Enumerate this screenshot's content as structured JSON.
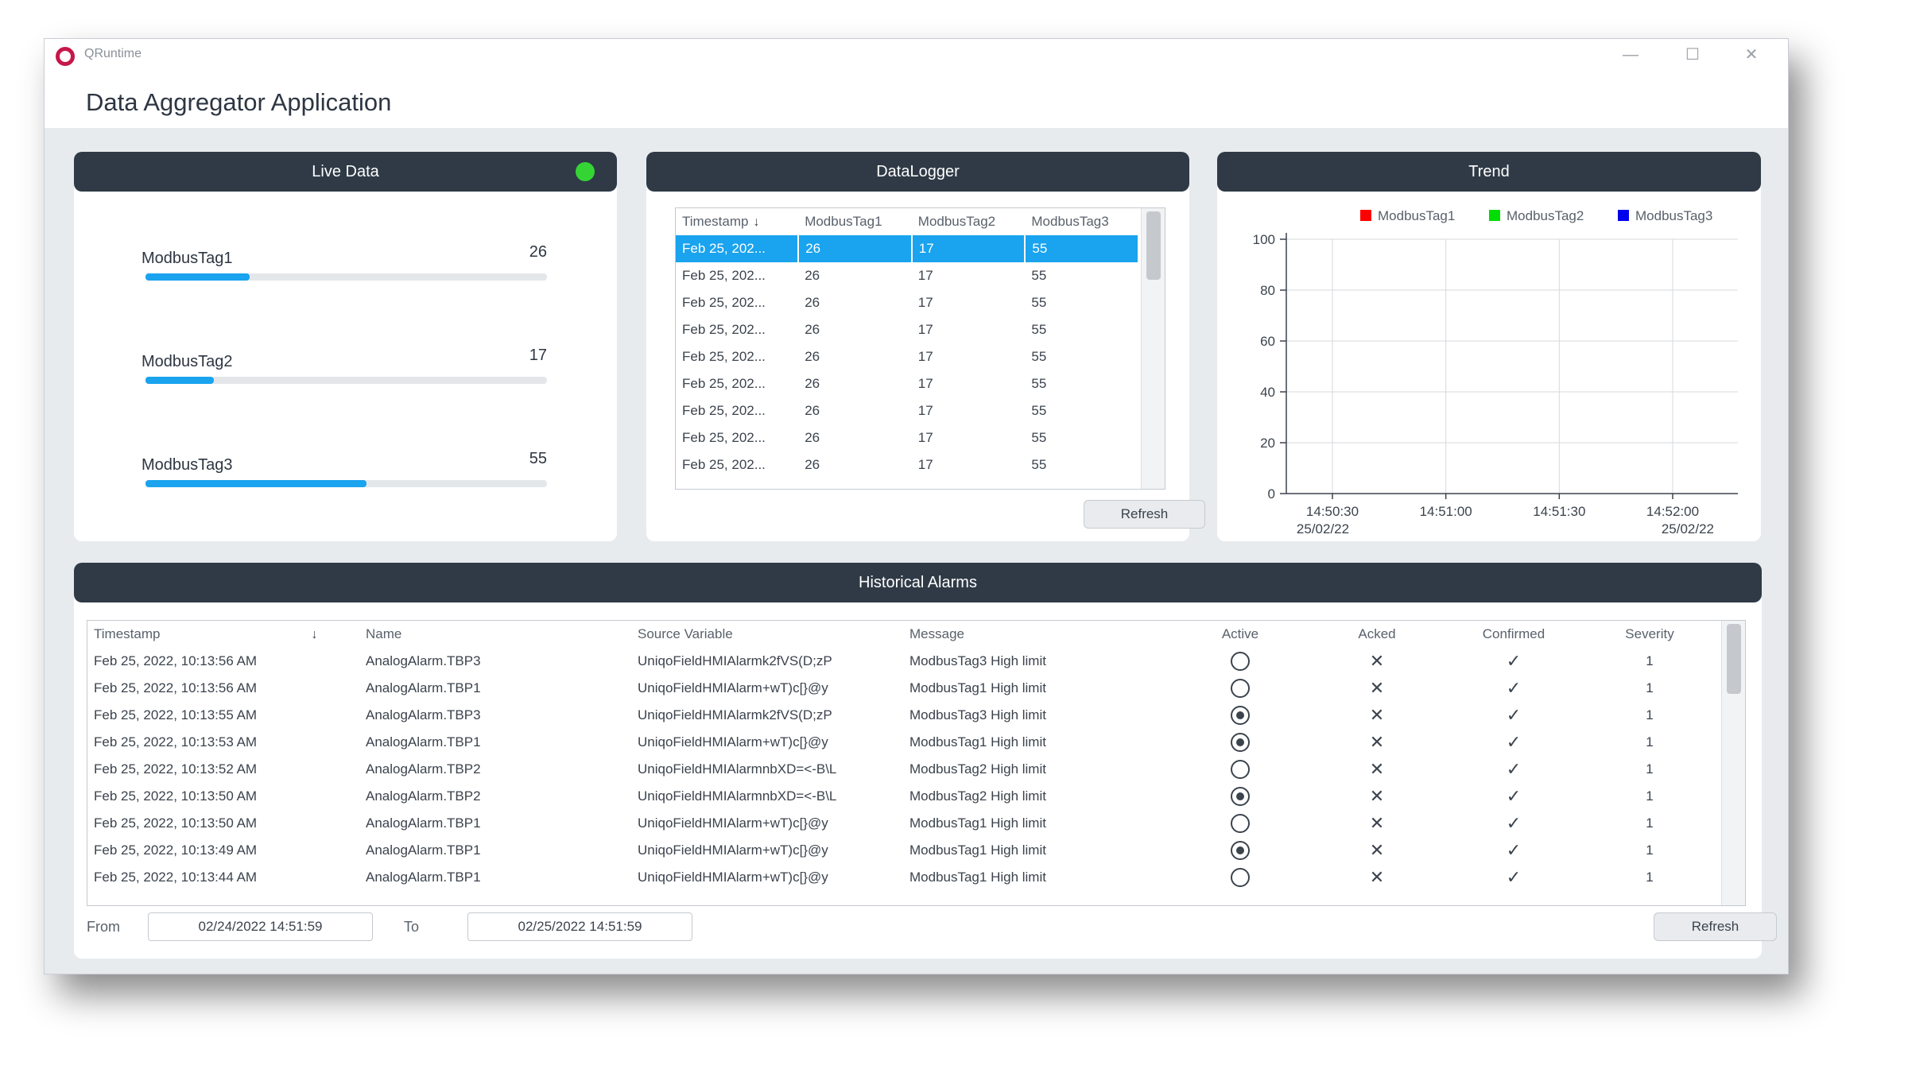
{
  "window": {
    "app_name": "QRuntime",
    "title": "Data Aggregator Application",
    "controls": {
      "minimize": "—",
      "maximize": "☐",
      "close": "✕"
    }
  },
  "colors": {
    "header": "#2f3a46",
    "accent": "#1aa3ee",
    "status_ok": "#35d435"
  },
  "live_data": {
    "title": "Live Data",
    "tags": [
      {
        "label": "ModbusTag1",
        "value": "26",
        "fill": 0.26
      },
      {
        "label": "ModbusTag2",
        "value": "17",
        "fill": 0.17
      },
      {
        "label": "ModbusTag3",
        "value": "55",
        "fill": 0.55
      }
    ]
  },
  "datalogger": {
    "title": "DataLogger",
    "columns": [
      "Timestamp",
      "ModbusTag1",
      "ModbusTag2",
      "ModbusTag3"
    ],
    "rows": [
      [
        "Feb 25, 202...",
        "26",
        "17",
        "55"
      ],
      [
        "Feb 25, 202...",
        "26",
        "17",
        "55"
      ],
      [
        "Feb 25, 202...",
        "26",
        "17",
        "55"
      ],
      [
        "Feb 25, 202...",
        "26",
        "17",
        "55"
      ],
      [
        "Feb 25, 202...",
        "26",
        "17",
        "55"
      ],
      [
        "Feb 25, 202...",
        "26",
        "17",
        "55"
      ],
      [
        "Feb 25, 202...",
        "26",
        "17",
        "55"
      ],
      [
        "Feb 25, 202...",
        "26",
        "17",
        "55"
      ],
      [
        "Feb 25, 202...",
        "26",
        "17",
        "55"
      ]
    ],
    "refresh_label": "Refresh"
  },
  "trend": {
    "title": "Trend",
    "chart_data": {
      "type": "line",
      "title": "",
      "ylim": [
        0,
        100
      ],
      "yticks": [
        "0",
        "20",
        "40",
        "60",
        "80",
        "100"
      ],
      "xticks": [
        {
          "time": "14:50:30",
          "date": "25/02/22"
        },
        {
          "time": "14:51:00",
          "date": ""
        },
        {
          "time": "14:51:30",
          "date": ""
        },
        {
          "time": "14:52:00",
          "date": "25/02/22"
        }
      ],
      "series": [
        {
          "name": "ModbusTag1",
          "color": "#ff0000",
          "values": []
        },
        {
          "name": "ModbusTag2",
          "color": "#00dd00",
          "values": []
        },
        {
          "name": "ModbusTag3",
          "color": "#0000ee",
          "values": []
        }
      ],
      "grid": true,
      "legend": "top"
    }
  },
  "alarms": {
    "title": "Historical Alarms",
    "columns": [
      "Timestamp",
      "Name",
      "Source Variable",
      "Message",
      "Active",
      "Acked",
      "Confirmed",
      "Severity"
    ],
    "rows": [
      {
        "timestamp": "Feb 25, 2022, 10:13:56 AM",
        "name": "AnalogAlarm.TBP3",
        "source": "UniqoFieldHMIAlarmk2fVS(D;zP",
        "message": "ModbusTag3 High limit",
        "active": false,
        "acked": "✕",
        "confirmed": "✓",
        "severity": "1"
      },
      {
        "timestamp": "Feb 25, 2022, 10:13:56 AM",
        "name": "AnalogAlarm.TBP1",
        "source": "UniqoFieldHMIAlarm+wT)c[}@y",
        "message": "ModbusTag1 High limit",
        "active": false,
        "acked": "✕",
        "confirmed": "✓",
        "severity": "1"
      },
      {
        "timestamp": "Feb 25, 2022, 10:13:55 AM",
        "name": "AnalogAlarm.TBP3",
        "source": "UniqoFieldHMIAlarmk2fVS(D;zP",
        "message": "ModbusTag3 High limit",
        "active": true,
        "acked": "✕",
        "confirmed": "✓",
        "severity": "1"
      },
      {
        "timestamp": "Feb 25, 2022, 10:13:53 AM",
        "name": "AnalogAlarm.TBP1",
        "source": "UniqoFieldHMIAlarm+wT)c[}@y",
        "message": "ModbusTag1 High limit",
        "active": true,
        "acked": "✕",
        "confirmed": "✓",
        "severity": "1"
      },
      {
        "timestamp": "Feb 25, 2022, 10:13:52 AM",
        "name": "AnalogAlarm.TBP2",
        "source": "UniqoFieldHMIAlarmnbXD=<-B\\L",
        "message": "ModbusTag2 High limit",
        "active": false,
        "acked": "✕",
        "confirmed": "✓",
        "severity": "1"
      },
      {
        "timestamp": "Feb 25, 2022, 10:13:50 AM",
        "name": "AnalogAlarm.TBP2",
        "source": "UniqoFieldHMIAlarmnbXD=<-B\\L",
        "message": "ModbusTag2 High limit",
        "active": true,
        "acked": "✕",
        "confirmed": "✓",
        "severity": "1"
      },
      {
        "timestamp": "Feb 25, 2022, 10:13:50 AM",
        "name": "AnalogAlarm.TBP1",
        "source": "UniqoFieldHMIAlarm+wT)c[}@y",
        "message": "ModbusTag1 High limit",
        "active": false,
        "acked": "✕",
        "confirmed": "✓",
        "severity": "1"
      },
      {
        "timestamp": "Feb 25, 2022, 10:13:49 AM",
        "name": "AnalogAlarm.TBP1",
        "source": "UniqoFieldHMIAlarm+wT)c[}@y",
        "message": "ModbusTag1 High limit",
        "active": true,
        "acked": "✕",
        "confirmed": "✓",
        "severity": "1"
      },
      {
        "timestamp": "Feb 25, 2022, 10:13:44 AM",
        "name": "AnalogAlarm.TBP1",
        "source": "UniqoFieldHMIAlarm+wT)c[}@y",
        "message": "ModbusTag1 High limit",
        "active": false,
        "acked": "✕",
        "confirmed": "✓",
        "severity": "1"
      }
    ],
    "from_label": "From",
    "from_value": "02/24/2022 14:51:59",
    "to_label": "To",
    "to_value": "02/25/2022 14:51:59",
    "refresh_label": "Refresh"
  }
}
